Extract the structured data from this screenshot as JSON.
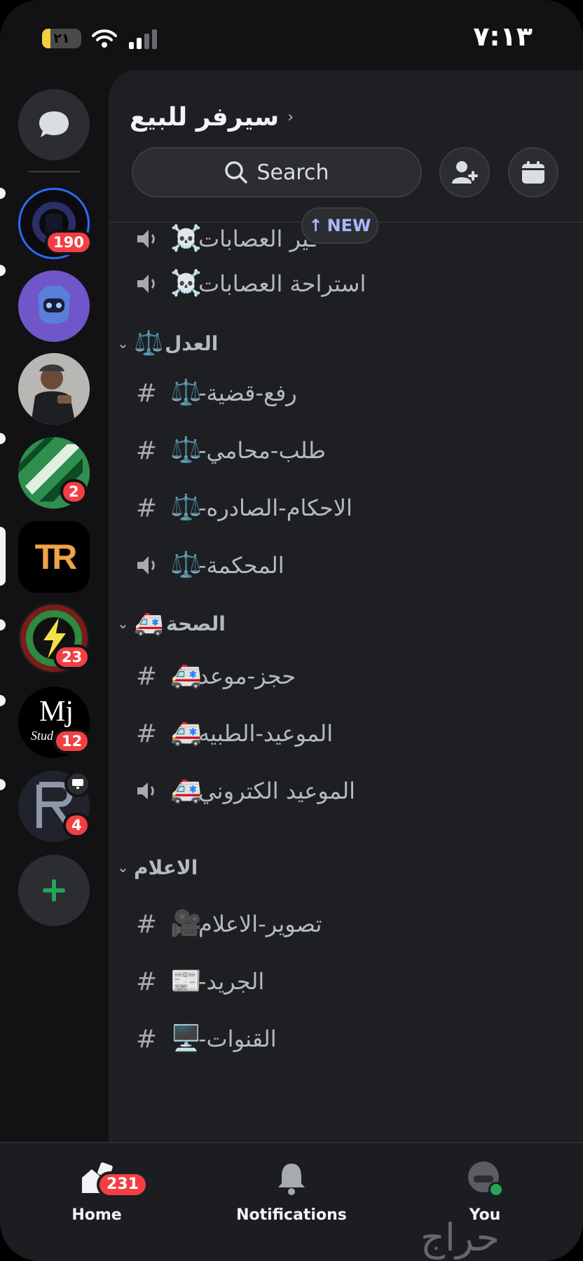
{
  "status_bar": {
    "time": "٧:١٣",
    "battery_level": "٢١",
    "battery_fraction": 0.21,
    "wifi_icon": "wifi-icon",
    "signal_icon": "cellular-signal-icon"
  },
  "server_rail": {
    "dm_icon": "chat-bubble-icon",
    "servers": [
      {
        "name": "server-1",
        "badge": "190",
        "unread": true
      },
      {
        "name": "server-2",
        "badge": "",
        "unread": true
      },
      {
        "name": "server-3",
        "badge": "",
        "unread": false
      },
      {
        "name": "server-4",
        "badge": "2",
        "unread": true
      },
      {
        "name": "server-5",
        "badge": "",
        "selected": true,
        "logo_text": "TR"
      },
      {
        "name": "server-6",
        "badge": "23",
        "unread": true
      },
      {
        "name": "server-7",
        "badge": "12",
        "unread": true,
        "logo_text": "Mj",
        "logo_sub": "Stud"
      },
      {
        "name": "server-8",
        "badge": "4",
        "unread": true
      }
    ],
    "add_icon": "plus-icon"
  },
  "header": {
    "server_name": "سيرفر للبيع",
    "search_label": "Search",
    "invite_icon": "add-member-icon",
    "events_icon": "calendar-icon"
  },
  "new_pill": {
    "label": "NEW",
    "arrow": "↑"
  },
  "channels": {
    "top": [
      {
        "type": "stage",
        "emoji": "☠️",
        "name": "ـير العصابات"
      },
      {
        "type": "stage",
        "emoji": "☠️",
        "name": "استراحة العصابات"
      }
    ],
    "categories": [
      {
        "name": "العدل",
        "emoji": "⚖️",
        "channels": [
          {
            "type": "text",
            "emoji": "⚖️",
            "name": "رفع-قضية-"
          },
          {
            "type": "text",
            "emoji": "⚖️",
            "name": "طلب-محامي-"
          },
          {
            "type": "text",
            "emoji": "⚖️",
            "name": "الاحكام-الصادره-"
          },
          {
            "type": "stage",
            "emoji": "⚖️",
            "name": "المحكمة-"
          }
        ]
      },
      {
        "name": "الصحة",
        "emoji": "🚑",
        "channels": [
          {
            "type": "text",
            "emoji": "🚑",
            "name": "حجز-موعد"
          },
          {
            "type": "text",
            "emoji": "🚑",
            "name": "الموعيد-الطبيه"
          },
          {
            "type": "voice",
            "emoji": "🚑",
            "name": "الموعيد الكتروني"
          }
        ]
      },
      {
        "name": "الاعلام",
        "emoji": "",
        "channels": [
          {
            "type": "text",
            "emoji": "🎥",
            "name": "تصوير-الاعلام"
          },
          {
            "type": "text",
            "emoji": "📰",
            "name": "الجريد-"
          },
          {
            "type": "text",
            "emoji": "🖥️",
            "name": "القنوات-"
          }
        ]
      }
    ]
  },
  "bottom_nav": {
    "home_label": "Home",
    "home_badge": "231",
    "notifications_label": "Notifications",
    "you_label": "You"
  },
  "watermark": "حراج"
}
